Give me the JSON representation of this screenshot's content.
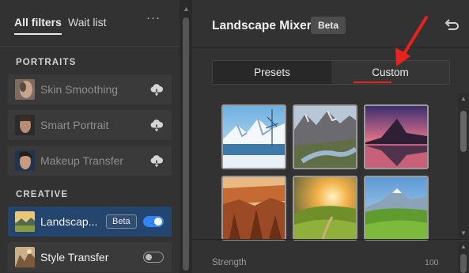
{
  "left_panel": {
    "tabs": {
      "all_filters": "All filters",
      "wait_list": "Wait list",
      "more": "···"
    },
    "portraits": {
      "heading": "PORTRAITS",
      "items": [
        {
          "label": "Skin Smoothing",
          "icon": "cloud-download-icon"
        },
        {
          "label": "Smart Portrait",
          "icon": "cloud-download-icon"
        },
        {
          "label": "Makeup Transfer",
          "icon": "cloud-download-icon"
        }
      ]
    },
    "creative": {
      "heading": "CREATIVE",
      "items": [
        {
          "label": "Landscap...",
          "badge": "Beta",
          "enabled": true
        },
        {
          "label": "Style Transfer",
          "enabled": false
        }
      ]
    }
  },
  "right_panel": {
    "title": "Landscape Mixer",
    "title_badge": "Beta",
    "undo_icon": "undo-icon",
    "segments": {
      "presets": "Presets",
      "custom": "Custom",
      "selected": "Custom"
    },
    "presets": [
      {
        "name": "snowy-mountain-lake"
      },
      {
        "name": "mountain-valley-river"
      },
      {
        "name": "sunset-mountain-reflection"
      },
      {
        "name": "canyon"
      },
      {
        "name": "sunrise-meadow"
      },
      {
        "name": "green-hills-mountain"
      }
    ],
    "strength": {
      "label": "Strength",
      "value": "100"
    }
  },
  "colors": {
    "active_row": "#24456e",
    "toggle_on": "#2f86f4",
    "annotation_red": "#e8231f"
  }
}
